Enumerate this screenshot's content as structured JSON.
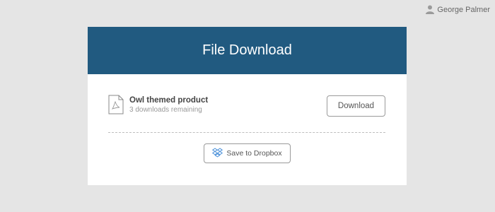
{
  "user": {
    "name": "George Palmer",
    "icon": "user-icon"
  },
  "card": {
    "title": "File Download",
    "header_color": "#215a80"
  },
  "file": {
    "name": "Owl themed product",
    "remaining": "3 downloads remaining",
    "icon": "pdf-file-icon"
  },
  "actions": {
    "download_label": "Download",
    "dropbox_label": "Save to Dropbox",
    "dropbox_icon": "dropbox-icon"
  }
}
